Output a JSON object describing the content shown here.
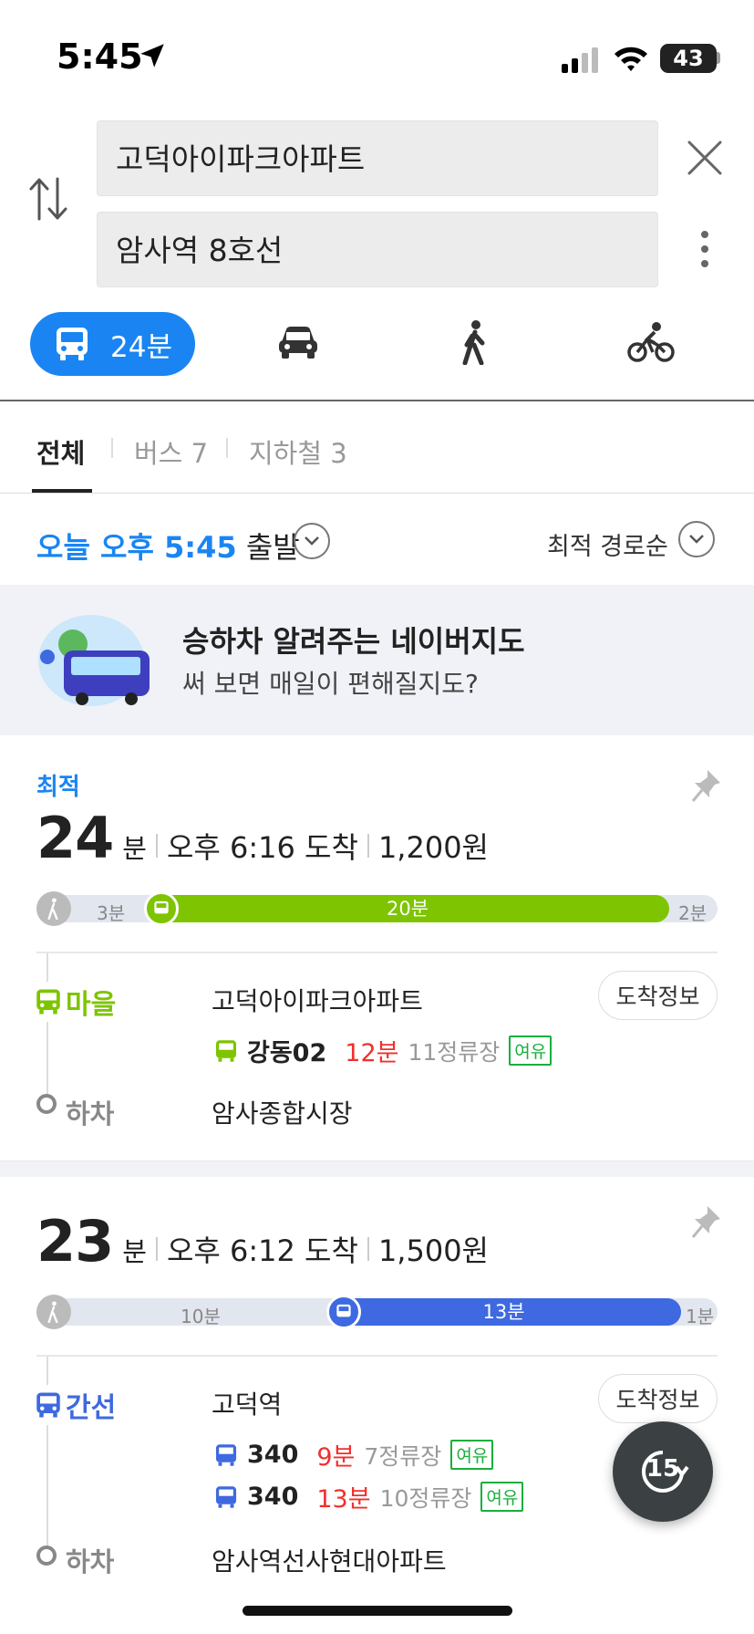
{
  "status_bar": {
    "time": "5:45",
    "battery": "43"
  },
  "search": {
    "origin": "고덕아이파크아파트",
    "destination": "암사역 8호선"
  },
  "modes": {
    "transit_label": "24분"
  },
  "filter_tabs": [
    {
      "label": "전체"
    },
    {
      "label": "버스 7"
    },
    {
      "label": "지하철 3"
    }
  ],
  "departure": {
    "time_label": "오늘 오후 5:45",
    "suffix": "출발",
    "sort_label": "최적 경로순"
  },
  "banner": {
    "title": "승하차 알려주는 네이버지도",
    "subtitle": "써 보면 매일이 편해질지도?"
  },
  "routes": [
    {
      "tag": "최적",
      "minutes": "24",
      "minutes_unit": "분",
      "arrival": "오후 6:16 도착",
      "fare": "1,200원",
      "bar": {
        "walk1": "3분",
        "ride": "20분",
        "walk2": "2분"
      },
      "bar_fractions": {
        "walk1": 0.1,
        "ride": 0.8,
        "walk2": 0.1
      },
      "type_label": "마을",
      "board_stop": "고덕아이파크아파트",
      "arrival_info_button": "도착정보",
      "buses": [
        {
          "number": "강동02",
          "eta": "12분",
          "stops": "11정류장",
          "status": "여유"
        }
      ],
      "alight_label": "하차",
      "alight_stop": "암사종합시장"
    },
    {
      "tag": "",
      "minutes": "23",
      "minutes_unit": "분",
      "arrival": "오후 6:12 도착",
      "fare": "1,500원",
      "bar": {
        "walk1": "10분",
        "ride": "13분",
        "walk2": "1분"
      },
      "bar_fractions": {
        "walk1": 0.42,
        "ride": 0.54,
        "walk2": 0.04
      },
      "type_label": "간선",
      "board_stop": "고덕역",
      "arrival_info_button": "도착정보",
      "buses": [
        {
          "number": "340",
          "eta": "9분",
          "stops": "7정류장",
          "status": "여유"
        },
        {
          "number": "340",
          "eta": "13분",
          "stops": "10정류장",
          "status": "여유"
        }
      ],
      "alight_label": "하차",
      "alight_stop": "암사역선사현대아파트"
    }
  ],
  "fab": {
    "label": "15"
  },
  "colors": {
    "accent": "#1a85f2",
    "village_bus": "#7ec400",
    "trunk_bus": "#3e69e0",
    "eta": "#f0302e",
    "status_ok": "#1aae3c"
  }
}
